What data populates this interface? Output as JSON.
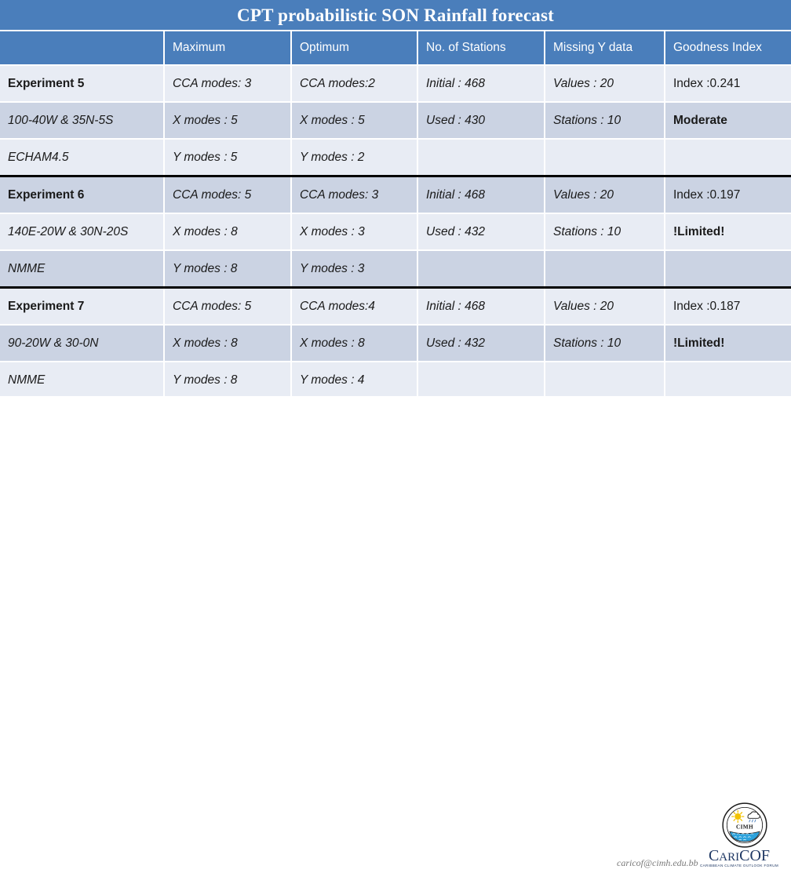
{
  "title": "CPT probabilistic SON Rainfall forecast",
  "table": {
    "columns": [
      "",
      "Maximum",
      "Optimum",
      "No. of Stations",
      "Missing Y data",
      "Goodness Index"
    ],
    "groups": [
      {
        "name": "Experiment 5",
        "rows": [
          [
            "Experiment 5",
            "CCA modes: 3",
            "CCA modes:2",
            "Initial : 468",
            "Values : 20",
            "Index :0.241"
          ],
          [
            "100-40W & 35N-5S",
            "X modes : 5",
            "X modes : 5",
            "Used : 430",
            "Stations : 10",
            "Moderate"
          ],
          [
            "ECHAM4.5",
            "Y modes : 5",
            "Y modes : 2",
            "",
            "",
            ""
          ]
        ]
      },
      {
        "name": "Experiment 6",
        "rows": [
          [
            "Experiment 6",
            "CCA modes: 5",
            "CCA modes: 3",
            "Initial : 468",
            "Values : 20",
            "Index :0.197"
          ],
          [
            "140E-20W & 30N-20S",
            "X modes : 8",
            "X modes : 3",
            "Used : 432",
            "Stations : 10",
            "!Limited!"
          ],
          [
            "NMME",
            "Y modes : 8",
            "Y modes : 3",
            "",
            "",
            ""
          ]
        ]
      },
      {
        "name": "Experiment 7",
        "rows": [
          [
            "Experiment 7",
            "CCA modes: 5",
            "CCA modes:4",
            "Initial : 468",
            "Values : 20",
            "Index :0.187"
          ],
          [
            "90-20W & 30-0N",
            "X modes : 8",
            "X modes : 8",
            "Used : 432",
            "Stations : 10",
            "!Limited!"
          ],
          [
            "NMME",
            "Y modes : 8",
            "Y modes : 4",
            "",
            "",
            ""
          ]
        ]
      }
    ]
  },
  "footer": {
    "email": "caricof@cimh.edu.bb",
    "logo_seal_text": "CIMH",
    "logo_wordmark_cari": "Cari",
    "logo_wordmark_cof": "COF",
    "logo_tagline": "CARIBBEAN CLIMATE OUTLOOK FORUM"
  },
  "colors": {
    "header_blue": "#4A7EBB",
    "row_light": "#E8ECF4",
    "row_dark": "#CBD3E3",
    "text": "#1a1a1a",
    "logo_navy": "#1F3864"
  }
}
